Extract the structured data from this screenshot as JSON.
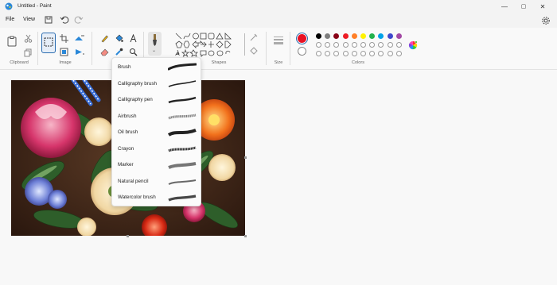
{
  "window": {
    "title": "Untitled - Paint",
    "minimize_icon": "minimize-icon",
    "maximize_icon": "maximize-icon",
    "close_icon": "close-icon"
  },
  "menu": {
    "file": "File",
    "view": "View"
  },
  "quick_access": {
    "icons": [
      "save-icon",
      "undo-icon",
      "redo-icon"
    ]
  },
  "ribbon": {
    "groups": {
      "clipboard": "Clipboard",
      "image": "Image",
      "shapes": "Shapes",
      "size": "Size",
      "colors": "Colors"
    }
  },
  "brushes": {
    "items": [
      {
        "label": "Brush"
      },
      {
        "label": "Calligraphy brush"
      },
      {
        "label": "Calligraphy pen"
      },
      {
        "label": "Airbrush"
      },
      {
        "label": "Oil brush"
      },
      {
        "label": "Crayon"
      },
      {
        "label": "Marker"
      },
      {
        "label": "Natural pencil"
      },
      {
        "label": "Watercolor brush"
      }
    ]
  },
  "colors": {
    "primary": "#e81123",
    "secondary": "#ffffff",
    "row1": [
      "#000000",
      "#7f7f7f",
      "#880015",
      "#ed1c24",
      "#ff7f27",
      "#fff200",
      "#22b14c",
      "#00a2e8",
      "#3f48cc",
      "#a349a4"
    ],
    "row2": [
      "#ffffff",
      "#c3c3c3",
      "#b97a57",
      "#ffaec9",
      "#ffc90e",
      "#efe4b0",
      "#b5e61d",
      "#99d9ea",
      "#7092be",
      "#c8bfe7"
    ]
  }
}
